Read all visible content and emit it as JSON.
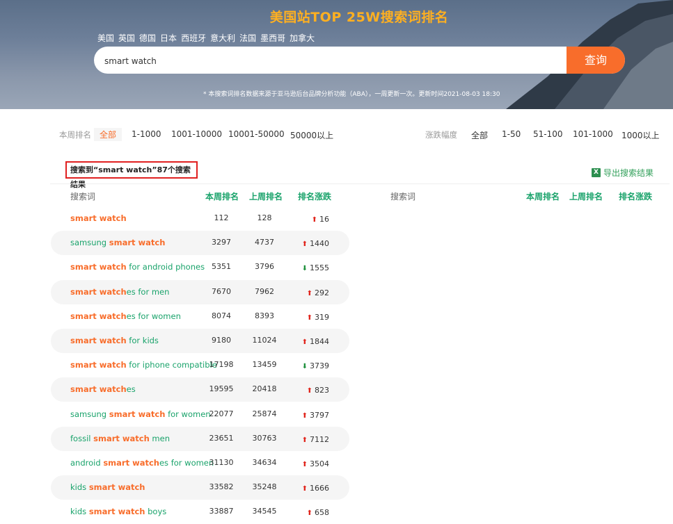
{
  "header": {
    "title": "美国站TOP 25W搜索词排名",
    "countries": [
      "美国",
      "英国",
      "德国",
      "日本",
      "西班牙",
      "意大利",
      "法国",
      "墨西哥",
      "加拿大"
    ],
    "search_value": "smart watch",
    "search_button": "查询",
    "note": "* 本搜索词排名数据来源于亚马逊后台品牌分析功能（ABA），一周更新一次。更新时间2021-08-03 18:30"
  },
  "filters": {
    "rank_label": "本周排名",
    "rank_options": [
      "全部",
      "1-1000",
      "1001-10000",
      "10001-50000",
      "50000以上"
    ],
    "change_label": "涨跌幅度",
    "change_options": [
      "全部",
      "1-50",
      "51-100",
      "101-1000",
      "1000以上"
    ]
  },
  "result_text": "搜索到“smart watch”87个搜索结果",
  "export_label": "导出搜索结果",
  "table": {
    "headers": [
      "搜索词",
      "本周排名",
      "上周排名",
      "排名涨跌"
    ],
    "rows": [
      {
        "pre": "",
        "hl": "smart watch",
        "post": "",
        "cur": "112",
        "prev": "128",
        "dir": "up",
        "chg": "16"
      },
      {
        "pre": "samsung ",
        "hl": "smart watch",
        "post": "",
        "cur": "3297",
        "prev": "4737",
        "dir": "up",
        "chg": "1440"
      },
      {
        "pre": "",
        "hl": "smart watch",
        "post": " for android phones",
        "cur": "5351",
        "prev": "3796",
        "dir": "down",
        "chg": "1555"
      },
      {
        "pre": "",
        "hl": "smart watch",
        "post": "es for men",
        "cur": "7670",
        "prev": "7962",
        "dir": "up",
        "chg": "292"
      },
      {
        "pre": "",
        "hl": "smart watch",
        "post": "es for women",
        "cur": "8074",
        "prev": "8393",
        "dir": "up",
        "chg": "319"
      },
      {
        "pre": "",
        "hl": "smart watch",
        "post": " for kids",
        "cur": "9180",
        "prev": "11024",
        "dir": "up",
        "chg": "1844"
      },
      {
        "pre": "",
        "hl": "smart watch",
        "post": " for iphone compatible",
        "cur": "17198",
        "prev": "13459",
        "dir": "down",
        "chg": "3739"
      },
      {
        "pre": "",
        "hl": "smart watch",
        "post": "es",
        "cur": "19595",
        "prev": "20418",
        "dir": "up",
        "chg": "823"
      },
      {
        "pre": "samsung ",
        "hl": "smart watch",
        "post": " for women",
        "cur": "22077",
        "prev": "25874",
        "dir": "up",
        "chg": "3797"
      },
      {
        "pre": "fossil ",
        "hl": "smart watch",
        "post": " men",
        "cur": "23651",
        "prev": "30763",
        "dir": "up",
        "chg": "7112"
      },
      {
        "pre": "android ",
        "hl": "smart watch",
        "post": "es for women",
        "cur": "31130",
        "prev": "34634",
        "dir": "up",
        "chg": "3504"
      },
      {
        "pre": "kids ",
        "hl": "smart watch",
        "post": "",
        "cur": "33582",
        "prev": "35248",
        "dir": "up",
        "chg": "1666"
      },
      {
        "pre": "kids ",
        "hl": "smart watch",
        "post": " boys",
        "cur": "33887",
        "prev": "34545",
        "dir": "up",
        "chg": "658"
      }
    ]
  },
  "colors": {
    "accent": "#f86d2b",
    "green": "#1aa36b",
    "title": "#ffb020",
    "up": "#e0231a",
    "down": "#1b8e3a"
  },
  "icons": {
    "up": "arrow-up-icon",
    "down": "arrow-down-icon",
    "export": "excel-icon"
  }
}
